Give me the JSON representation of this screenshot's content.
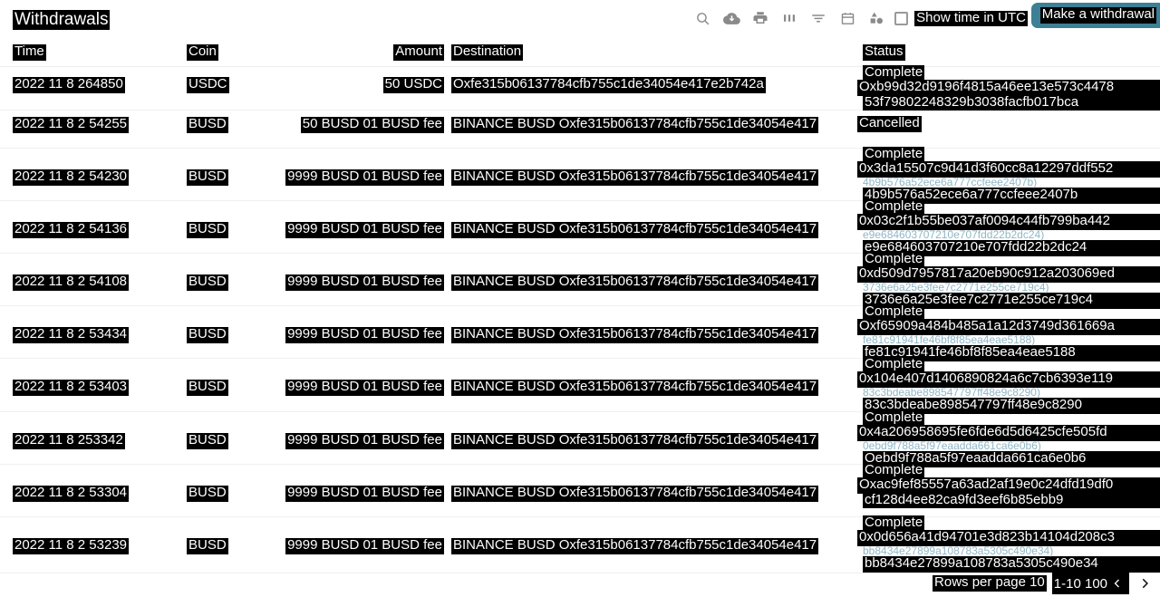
{
  "header": {
    "title": "Withdrawals",
    "utc_toggle_label": "Show time in UTC",
    "withdraw_button": "Make a withdrawal",
    "accent_color": "#3d7f94",
    "icons": [
      {
        "name": "search-icon"
      },
      {
        "name": "cloud-download-icon"
      },
      {
        "name": "print-icon"
      },
      {
        "name": "view-columns-icon"
      },
      {
        "name": "filter-icon"
      },
      {
        "name": "calendar-icon"
      },
      {
        "name": "shapes-icon"
      }
    ]
  },
  "table": {
    "columns": [
      "Time",
      "Coin",
      "Amount",
      "Destination",
      "Status"
    ],
    "rows": [
      {
        "time": "2022 11 8 264850",
        "coin": "USDC",
        "amount": "50 USDC",
        "destination": "Oxfe315b06137784cfb755c1de34054e417e2b742a",
        "status_state": "Complete",
        "status_hash": "Oxb99d32d9196f4815a46ee13e573c4478",
        "status_link": "",
        "status_hash2": "53f79802248329b3038facfb017bca"
      },
      {
        "time": "2022 11 8 2 54255",
        "coin": "BUSD",
        "amount": "50 BUSD 01 BUSD fee",
        "destination": "BINANCE BUSD Oxfe315b06137784cfb755c1de34054e417",
        "status_state": "Cancelled",
        "status_hash": "",
        "status_link": "",
        "status_hash2": ""
      },
      {
        "time": "2022 11 8 2 54230",
        "coin": "BUSD",
        "amount": "9999 BUSD 01 BUSD fee",
        "destination": "BINANCE BUSD Oxfe315b06137784cfb755c1de34054e417",
        "status_state": "Complete",
        "status_hash": "0x3da15507c9d41d3f60cc8a12297ddf552",
        "status_link": "4b9b576a52ece6a777ccfeee2407b)",
        "status_hash2": "4b9b576a52ece6a777ccfeee2407b"
      },
      {
        "time": "2022 11 8 2 54136",
        "coin": "BUSD",
        "amount": "9999 BUSD 01 BUSD fee",
        "destination": "BINANCE BUSD Oxfe315b06137784cfb755c1de34054e417",
        "status_state": "Complete",
        "status_hash": "0x03c2f1b55be037af0094c44fb799ba442",
        "status_link": "e9e684603707210e707fdd22b2dc24)",
        "status_hash2": "e9e684603707210e707fdd22b2dc24"
      },
      {
        "time": "2022 11 8 2 54108",
        "coin": "BUSD",
        "amount": "9999 BUSD 01 BUSD fee",
        "destination": "BINANCE BUSD Oxfe315b06137784cfb755c1de34054e417",
        "status_state": "Complete",
        "status_hash": "0xd509d7957817a20eb90c912a203069ed",
        "status_link": "3736e6a25e3fee7c2771e255ce719c4)",
        "status_hash2": "3736e6a25e3fee7c2771e255ce719c4"
      },
      {
        "time": "2022 11 8 2 53434",
        "coin": "BUSD",
        "amount": "9999 BUSD 01 BUSD fee",
        "destination": "BINANCE BUSD Oxfe315b06137784cfb755c1de34054e417",
        "status_state": "Complete",
        "status_hash": "Oxf65909a484b485a1a12d3749d361669a",
        "status_link": "fe81c91941fe46bf8f85ea4eae5188)",
        "status_hash2": "fe81c91941fe46bf8f85ea4eae5188"
      },
      {
        "time": "2022 11 8 2 53403",
        "coin": "BUSD",
        "amount": "9999 BUSD 01 BUSD fee",
        "destination": "BINANCE BUSD Oxfe315b06137784cfb755c1de34054e417",
        "status_state": "Complete",
        "status_hash": "0x104e407d1406890824a6c7cb6393e119",
        "status_link": "83c3bdeabe898547797ff48e9c8290)",
        "status_hash2": "83c3bdeabe898547797ff48e9c8290"
      },
      {
        "time": "2022 11 8 253342",
        "coin": "BUSD",
        "amount": "9999 BUSD 01 BUSD fee",
        "destination": "BINANCE BUSD Oxfe315b06137784cfb755c1de34054e417",
        "status_state": "Complete",
        "status_hash": "0x4a206958695fe6fde6d5d6425cfe505fd",
        "status_link": "0ebd9f788a5f97eaadda661ca6e0b6)",
        "status_hash2": "Oebd9f788a5f97eaadda661ca6e0b6"
      },
      {
        "time": "2022 11 8 2 53304",
        "coin": "BUSD",
        "amount": "9999 BUSD 01 BUSD fee",
        "destination": "BINANCE BUSD Oxfe315b06137784cfb755c1de34054e417",
        "status_state": "Complete",
        "status_hash": "Oxac9fef85557a63ad2af19e0c24dfd19df0",
        "status_link": "",
        "status_hash2": "cf128d4ee82ca9fd3eef6b85ebb9"
      },
      {
        "time": "2022 11 8 2 53239",
        "coin": "BUSD",
        "amount": "9999 BUSD 01 BUSD fee",
        "destination": "BINANCE BUSD Oxfe315b06137784cfb755c1de34054e417",
        "status_state": "Complete",
        "status_hash": "0x0d656a41d94701e3d823b14104d208c3",
        "status_link": "bb8434e27899a108783a5305c490e34)",
        "status_hash2": "bb8434e27899a108783a5305c490e34"
      }
    ]
  },
  "pagination": {
    "rows_per_page_label": "Rows per page 10",
    "range_label": "1-10 100",
    "prev_icon": "chevron-left-icon",
    "next_icon": "chevron-right-icon"
  }
}
